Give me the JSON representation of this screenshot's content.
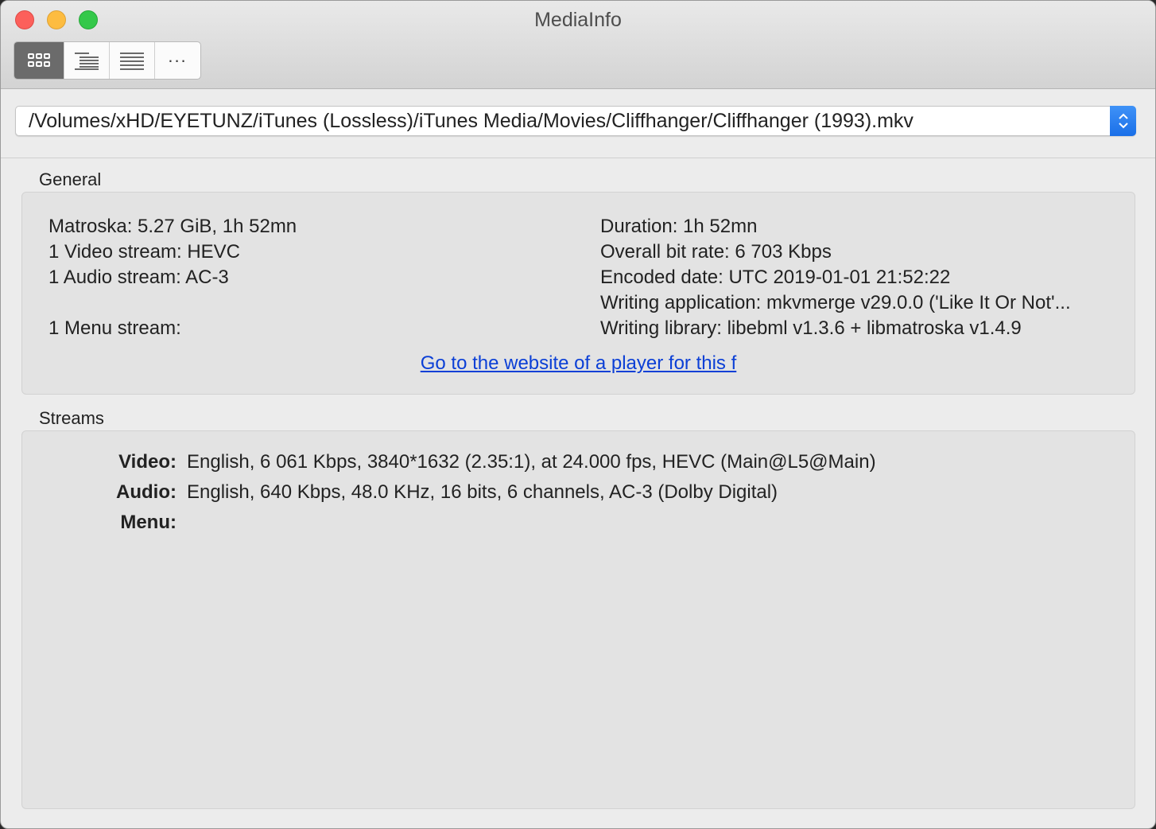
{
  "window": {
    "title": "MediaInfo"
  },
  "toolbar": {
    "segments": [
      {
        "icon": "grid-icon",
        "active": true
      },
      {
        "icon": "tree-list-icon",
        "active": false
      },
      {
        "icon": "text-list-icon",
        "active": false
      },
      {
        "label": "...",
        "active": false
      }
    ]
  },
  "file": {
    "path": "/Volumes/xHD/EYETUNZ/iTunes (Lossless)/iTunes Media/Movies/Cliffhanger/Cliffhanger (1993).mkv"
  },
  "general": {
    "title": "General",
    "left": [
      "Matroska: 5.27 GiB, 1h 52mn",
      "1 Video stream: HEVC",
      "1 Audio stream: AC-3",
      "",
      "1 Menu stream:"
    ],
    "right": [
      "Duration: 1h 52mn",
      "Overall bit rate: 6 703 Kbps",
      "Encoded date: UTC 2019-01-01 21:52:22",
      "Writing application: mkvmerge v29.0.0 ('Like It Or Not'...",
      "Writing library: libebml v1.3.6 + libmatroska v1.4.9"
    ],
    "player_link": "Go to the website of a player for this f"
  },
  "streams": {
    "title": "Streams",
    "items": [
      {
        "label": "Video:",
        "value": "English, 6 061 Kbps, 3840*1632 (2.35:1), at 24.000 fps, HEVC (Main@L5@Main)"
      },
      {
        "label": "Audio:",
        "value": "English, 640 Kbps, 48.0 KHz, 16 bits, 6 channels, AC-3 (Dolby Digital)"
      },
      {
        "label": "Menu:",
        "value": ""
      }
    ]
  },
  "colors": {
    "link": "#0b3fd6",
    "accent": "#1a6fe8",
    "close": "#fc605b",
    "minimize": "#fdbc40",
    "zoom": "#34c84a"
  }
}
